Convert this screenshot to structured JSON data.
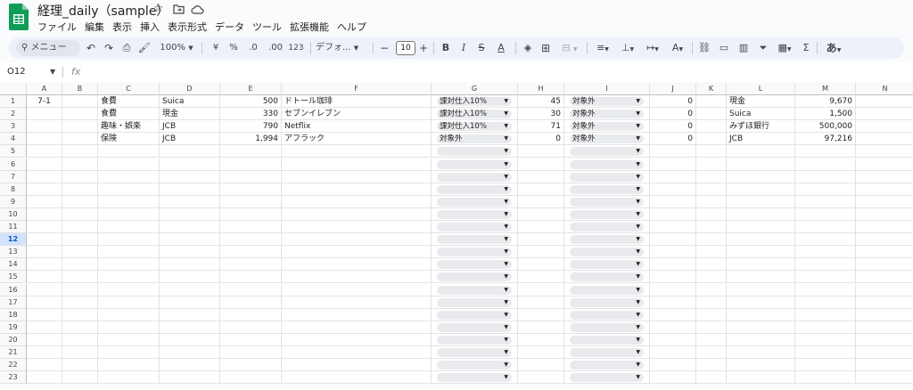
{
  "app": {
    "title": "経理_daily（sample）",
    "icons": [
      "star-icon",
      "move-to-folder-icon",
      "cloud-saved-icon"
    ]
  },
  "menu": [
    "ファイル",
    "編集",
    "表示",
    "挿入",
    "表示形式",
    "データ",
    "ツール",
    "拡張機能",
    "ヘルプ"
  ],
  "toolbar": {
    "search_placeholder": "メニュー",
    "zoom": "100%",
    "currency": "¥",
    "percent": "%",
    "decrease_decimal": ".0",
    "increase_decimal": ".00",
    "format_123": "123",
    "font": "デフォ...",
    "font_size": "10",
    "minus": "−",
    "plus": "+",
    "bold": "B",
    "italic": "I",
    "strike": "S",
    "text_color": "A",
    "input_tools": "あ",
    "sigma": "Σ"
  },
  "formula_bar": {
    "cell_ref": "O12",
    "fx": "fx"
  },
  "columns": [
    "A",
    "B",
    "C",
    "D",
    "E",
    "F",
    "G",
    "H",
    "I",
    "J",
    "K",
    "L",
    "M",
    "N"
  ],
  "rows": [
    {
      "num": "1",
      "A": "7-1",
      "C": "食費",
      "D": "Suica",
      "E": "500",
      "F": "ドトール珈琲",
      "G": "課対仕入10%",
      "H": "45",
      "I": "対象外",
      "J": "0",
      "L": "現金",
      "M": "9,670"
    },
    {
      "num": "2",
      "C": "食費",
      "D": "現金",
      "E": "330",
      "F": "セブンイレブン",
      "G": "課対仕入10%",
      "H": "30",
      "I": "対象外",
      "J": "0",
      "L": "Suica",
      "M": "1,500"
    },
    {
      "num": "3",
      "C": "趣味・娯楽",
      "D": "JCB",
      "E": "790",
      "F": "Netflix",
      "G": "課対仕入10%",
      "H": "71",
      "I": "対象外",
      "J": "0",
      "L": "みずほ銀行",
      "M": "500,000"
    },
    {
      "num": "4",
      "C": "保険",
      "D": "JCB",
      "E": "1,994",
      "F": "アフラック",
      "G": "対象外",
      "H": "0",
      "I": "対象外",
      "J": "0",
      "L": "JCB",
      "M": "97,216"
    },
    {
      "num": "5"
    },
    {
      "num": "6"
    },
    {
      "num": "7"
    },
    {
      "num": "8"
    },
    {
      "num": "9"
    },
    {
      "num": "10"
    },
    {
      "num": "11"
    },
    {
      "num": "12"
    },
    {
      "num": "13"
    },
    {
      "num": "14"
    },
    {
      "num": "15"
    },
    {
      "num": "16"
    },
    {
      "num": "17"
    },
    {
      "num": "18"
    },
    {
      "num": "19"
    },
    {
      "num": "20"
    },
    {
      "num": "21"
    },
    {
      "num": "22"
    },
    {
      "num": "23"
    }
  ],
  "active_row": "12",
  "colors": {
    "accent": "#0b57d0",
    "sheets_green": "#0f9d58",
    "toolbar_bg": "#edf2fa",
    "chip_bg": "#e8eaed"
  }
}
